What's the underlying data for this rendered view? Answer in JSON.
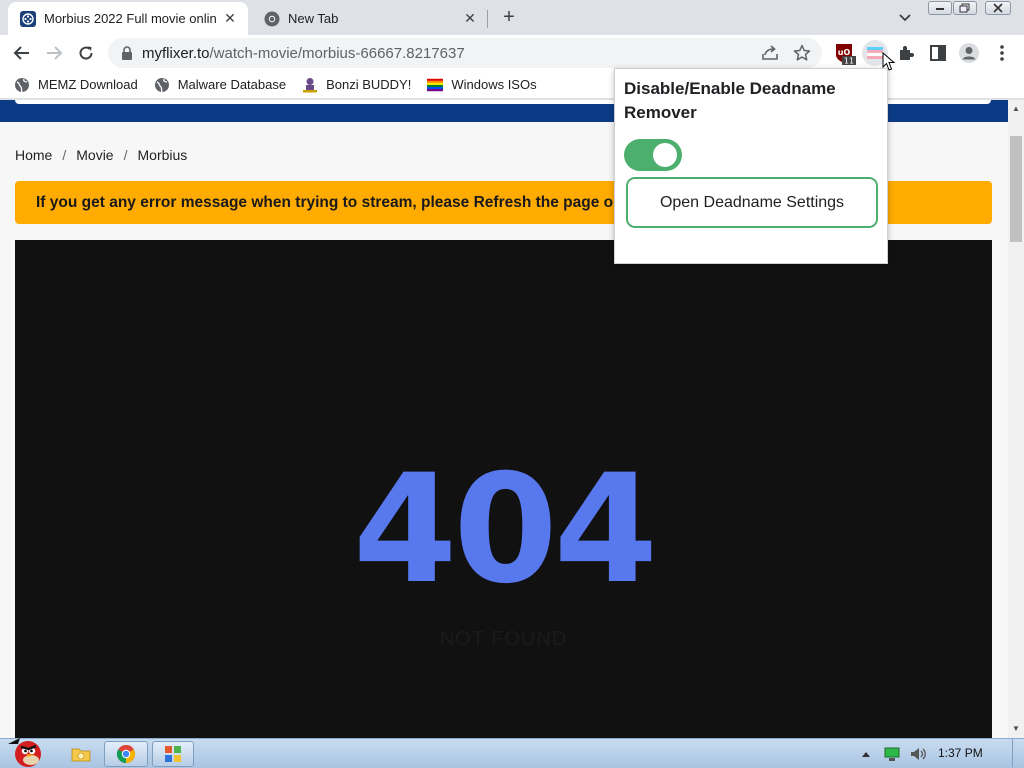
{
  "tabs": [
    {
      "title": "Morbius 2022 Full movie onlin",
      "active": true,
      "icon": "film-reel-icon"
    },
    {
      "title": "New Tab",
      "active": false,
      "icon": "chrome-icon"
    }
  ],
  "address": {
    "host": "myflixer.to",
    "path": "/watch-movie/morbius-66667.8217637"
  },
  "extension_badge": "11",
  "bookmarks": [
    {
      "label": "MEMZ Download",
      "icon": "globe-icon"
    },
    {
      "label": "Malware Database",
      "icon": "globe-icon"
    },
    {
      "label": "Bonzi BUDDY!",
      "icon": "bonzi-icon"
    },
    {
      "label": "Windows ISOs",
      "icon": "rainbow-flag-icon"
    }
  ],
  "breadcrumb": {
    "home": "Home",
    "movie": "Movie",
    "current": "Morbius",
    "separator": "/"
  },
  "alert": {
    "text": "If you get any error message when trying to stream, please Refresh the page or s"
  },
  "player": {
    "code": "404",
    "message": "NOT FOUND"
  },
  "popup": {
    "title": "Disable/Enable Deadname Remover",
    "toggle_on": true,
    "button": "Open Deadname Settings"
  },
  "taskbar": {
    "time": "1:37 PM"
  },
  "colors": {
    "accent_green": "#4caf6e",
    "alert": "#ffab00",
    "navy": "#0c3b86",
    "error_blue": "#5878ee"
  }
}
